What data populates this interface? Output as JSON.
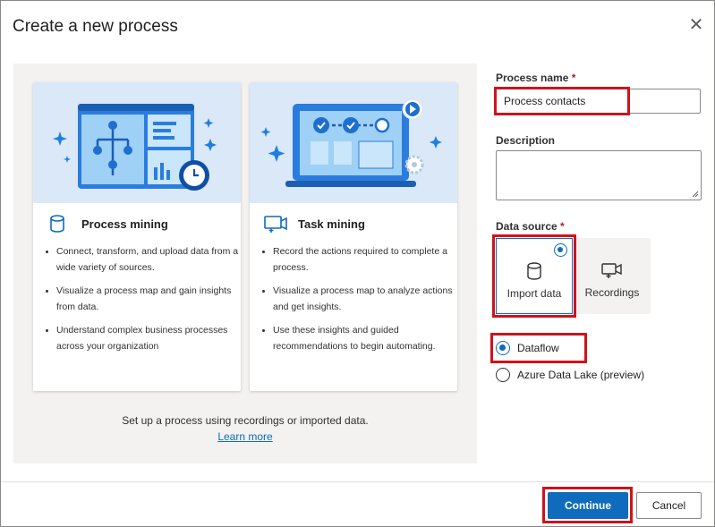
{
  "dialog": {
    "title": "Create a new process",
    "close_icon": "close-icon"
  },
  "cards": [
    {
      "title": "Process mining",
      "icon": "database-icon",
      "bullets": [
        "Connect, transform, and upload data from a wide variety of sources.",
        "Visualize a process map and gain insights from data.",
        "Understand complex business processes across your organization"
      ]
    },
    {
      "title": "Task mining",
      "icon": "screen-recording-icon",
      "bullets": [
        "Record the actions required to complete a process.",
        "Visualize a process map to analyze actions and get insights.",
        "Use these insights and guided recommendations to begin automating."
      ]
    }
  ],
  "panel_footer": {
    "text": "Set up a process using recordings or imported data.",
    "link": "Learn more"
  },
  "form": {
    "process_name_label": "Process name",
    "required_marker": "*",
    "process_name_value": "Process contacts",
    "description_label": "Description",
    "description_value": "",
    "data_source_label": "Data source",
    "data_source_options": [
      {
        "label": "Import data",
        "icon": "database-icon",
        "selected": true
      },
      {
        "label": "Recordings",
        "icon": "video-camera-icon",
        "selected": false
      }
    ],
    "import_options": [
      {
        "label": "Dataflow",
        "selected": true
      },
      {
        "label": "Azure Data Lake (preview)",
        "selected": false
      }
    ]
  },
  "footer": {
    "continue_label": "Continue",
    "cancel_label": "Cancel"
  },
  "colors": {
    "accent": "#0f6cbd",
    "highlight": "#d0121b",
    "panel_bg": "#f3f2f1",
    "hero_bg": "#dbe8f8"
  }
}
